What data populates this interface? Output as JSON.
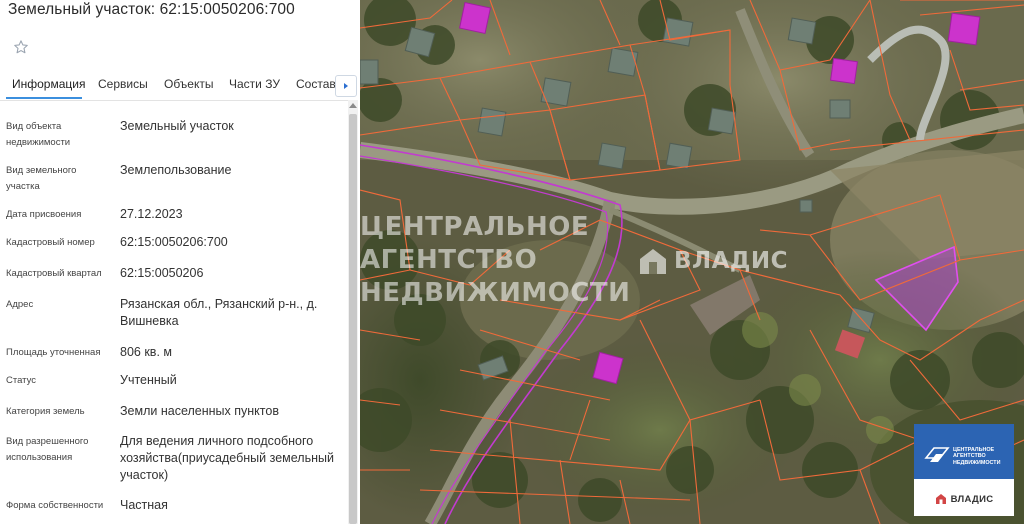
{
  "panel": {
    "title": "Земельный участок: 62:15:0050206:700",
    "favorite_icon": "star-icon"
  },
  "tabs": [
    {
      "label": "Информация",
      "active": true
    },
    {
      "label": "Сервисы",
      "active": false
    },
    {
      "label": "Объекты",
      "active": false
    },
    {
      "label": "Части ЗУ",
      "active": false
    },
    {
      "label": "Состав",
      "active": false
    }
  ],
  "tabs_next_icon": "chevron-right-icon",
  "info": {
    "object_type": {
      "label": "Вид объекта недвижимости",
      "value": "Земельный участок"
    },
    "land_type": {
      "label": "Вид земельного участка",
      "value": "Землепользование"
    },
    "assigned_date": {
      "label": "Дата присвоения",
      "value": "27.12.2023"
    },
    "cadastral_number": {
      "label": "Кадастровый номер",
      "value": "62:15:0050206:700"
    },
    "cadastral_quarter": {
      "label": "Кадастровый квартал",
      "value": "62:15:0050206"
    },
    "address": {
      "label": "Адрес",
      "value": "Рязанская обл., Рязанский р-н., д. Вишневка"
    },
    "area": {
      "label": "Площадь уточненная",
      "value": "806 кв. м"
    },
    "status": {
      "label": "Статус",
      "value": "Учтенный"
    },
    "land_category": {
      "label": "Категория земель",
      "value": "Земли населенных пунктов"
    },
    "permitted_use": {
      "label": "Вид разрешенного использования",
      "value": "Для ведения личного подсобного хозяйства(приусадебный земельный участок)"
    },
    "ownership": {
      "label": "Форма собственности",
      "value": "Частная"
    }
  },
  "map": {
    "watermark_lines": [
      "ЦЕНТРАЛЬНОЕ",
      "АГЕНТСТВО",
      "НЕДВИЖИМОСТИ"
    ],
    "watermark_brand": "ВЛАДИС",
    "parcel_border_color": "#ff6b3d",
    "highlight_color": "#d63bd6",
    "brand_box": {
      "name_lines": [
        "ЦЕНТРАЛЬНОЕ",
        "АГЕНТСТВО",
        "НЕДВИЖИМОСТИ"
      ],
      "brand": "ВЛАДИС",
      "color": "#2c64b3"
    }
  }
}
